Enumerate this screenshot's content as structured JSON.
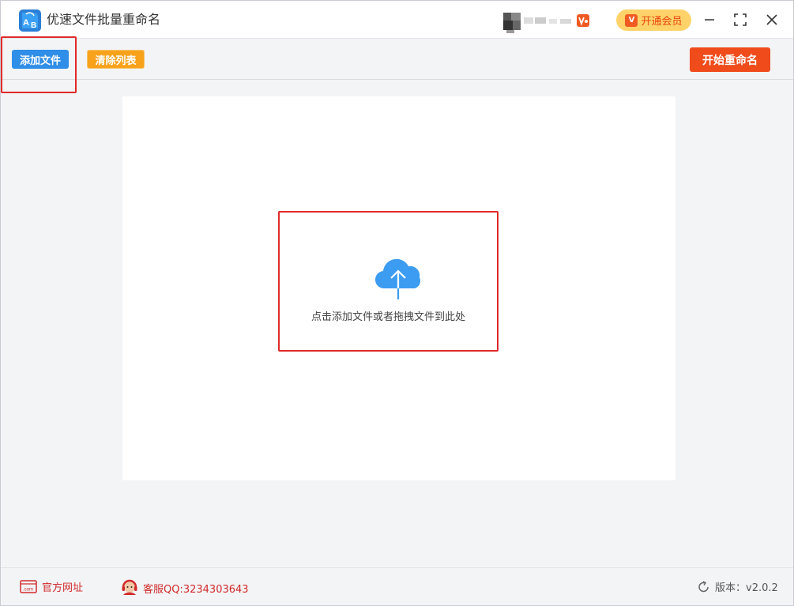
{
  "app": {
    "title": "优速文件批量重命名",
    "logo_icon": "ab-rename-logo-icon",
    "vip_button_label": "开通会员",
    "vip_badge": "V"
  },
  "toolbar": {
    "add_files_label": "添加文件",
    "clear_list_label": "清除列表",
    "start_rename_label": "开始重命名"
  },
  "dropzone": {
    "hint": "点击添加文件或者拖拽文件到此处",
    "icon": "cloud-upload-icon"
  },
  "footer": {
    "website_label": "官方网址",
    "support_label": "客服QQ:3234303643",
    "version_label": "版本：v2.0.2"
  },
  "colors": {
    "add_button": "#2f8ee8",
    "clear_button": "#f8a21b",
    "start_button": "#ef4b1b",
    "vip_button": "#ffd36a",
    "highlight": "#e02a2a",
    "upload_icon": "#3c9cf2"
  }
}
